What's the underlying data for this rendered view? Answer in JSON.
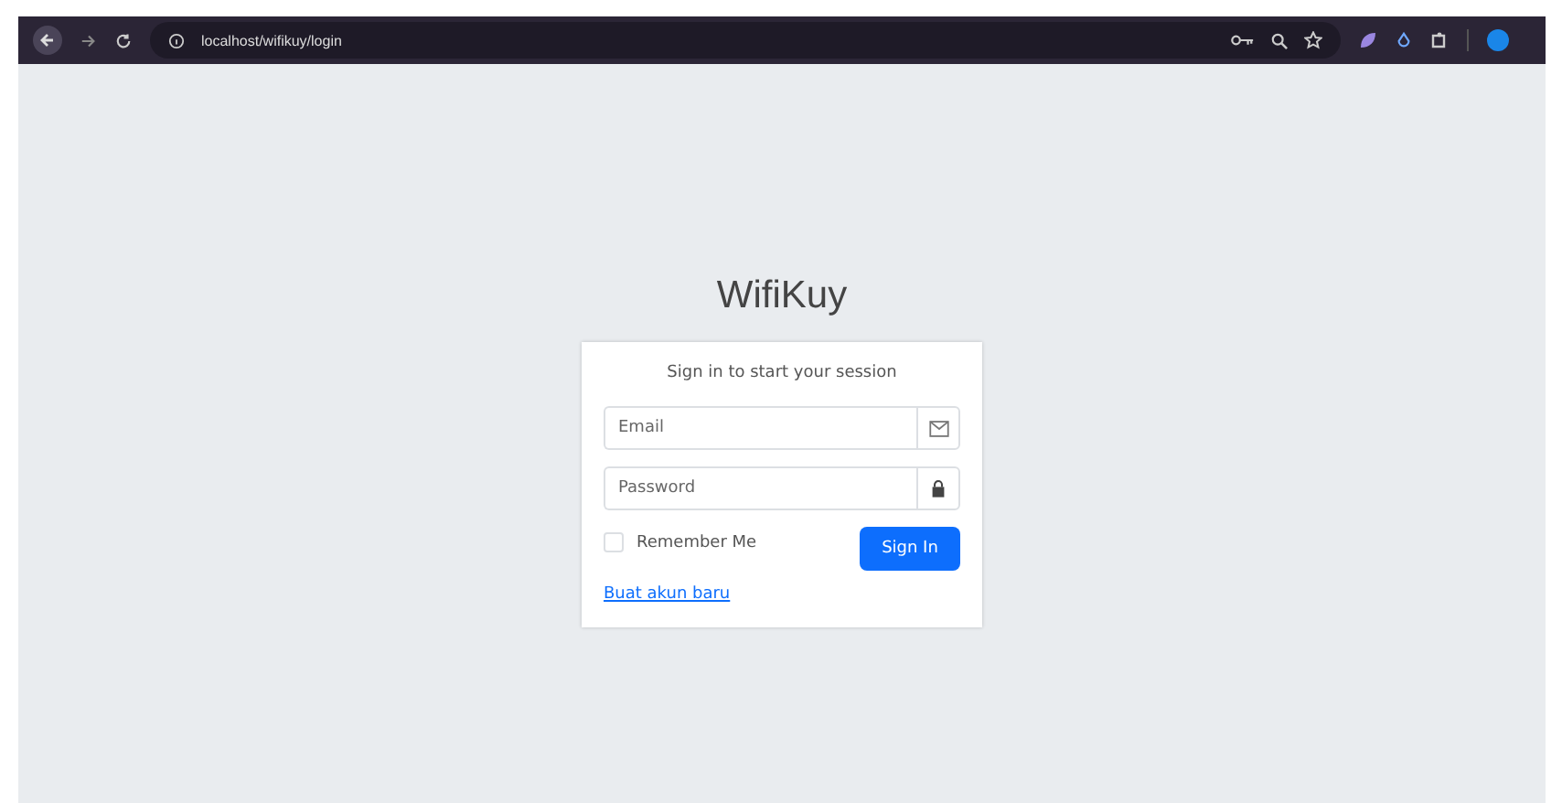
{
  "browser": {
    "url": "localhost/wifikuy/login"
  },
  "page": {
    "logo": "WifiKuy",
    "login_box": {
      "message": "Sign in to start your session",
      "fields": [
        {
          "placeholder": "Email",
          "kind": "email"
        },
        {
          "placeholder": "Password",
          "kind": "password"
        }
      ],
      "remember": {
        "label": "Remember Me",
        "checked": false
      },
      "button": "Sign In",
      "link": "Buat akun baru"
    }
  }
}
